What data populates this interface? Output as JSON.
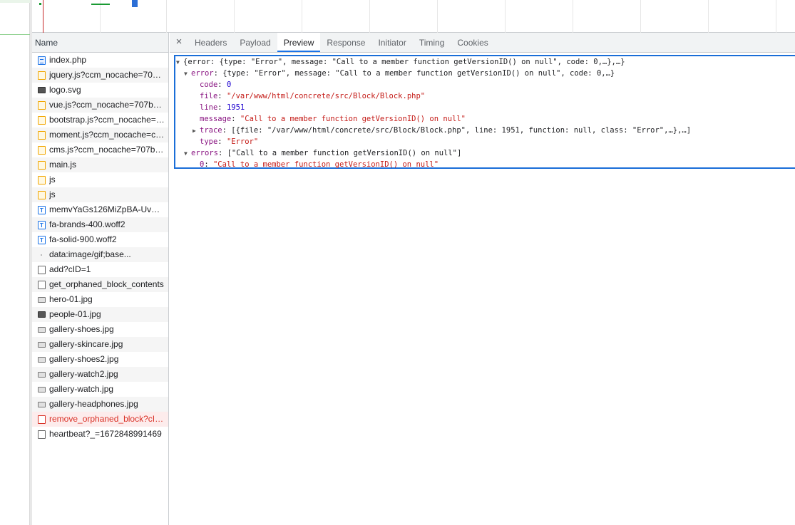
{
  "list": {
    "header": "Name",
    "rows": [
      {
        "name": "index.php",
        "icon": "document-icon",
        "alt": false
      },
      {
        "name": "jquery.js?ccm_nocache=707b...",
        "icon": "script-icon",
        "alt": true
      },
      {
        "name": "logo.svg",
        "icon": "image-icon",
        "alt": false
      },
      {
        "name": "vue.js?ccm_nocache=707b9b...",
        "icon": "script-icon",
        "alt": true
      },
      {
        "name": "bootstrap.js?ccm_nocache=9...",
        "icon": "script-icon",
        "alt": false
      },
      {
        "name": "moment.js?ccm_nocache=c3...",
        "icon": "script-icon",
        "alt": true
      },
      {
        "name": "cms.js?ccm_nocache=707b9...",
        "icon": "script-icon",
        "alt": false
      },
      {
        "name": "main.js",
        "icon": "script-icon",
        "alt": true
      },
      {
        "name": "js",
        "icon": "script-icon",
        "alt": false
      },
      {
        "name": "js",
        "icon": "script-icon",
        "alt": true
      },
      {
        "name": "memvYaGs126MiZpBA-UvW...",
        "icon": "font-icon",
        "alt": false
      },
      {
        "name": "fa-brands-400.woff2",
        "icon": "font-icon",
        "alt": true
      },
      {
        "name": "fa-solid-900.woff2",
        "icon": "font-icon",
        "alt": false
      },
      {
        "name": "data:image/gif;base...",
        "icon": "tiny-image-icon",
        "alt": true
      },
      {
        "name": "add?cID=1",
        "icon": "blank-document-icon",
        "alt": false
      },
      {
        "name": "get_orphaned_block_contents",
        "icon": "blank-document-icon",
        "alt": true
      },
      {
        "name": "hero-01.jpg",
        "icon": "image-icon",
        "alt": false
      },
      {
        "name": "people-01.jpg",
        "icon": "image-icon",
        "alt": true
      },
      {
        "name": "gallery-shoes.jpg",
        "icon": "image-icon",
        "alt": false
      },
      {
        "name": "gallery-skincare.jpg",
        "icon": "image-icon",
        "alt": true
      },
      {
        "name": "gallery-shoes2.jpg",
        "icon": "image-icon",
        "alt": false
      },
      {
        "name": "gallery-watch2.jpg",
        "icon": "image-icon",
        "alt": true
      },
      {
        "name": "gallery-watch.jpg",
        "icon": "image-icon",
        "alt": false
      },
      {
        "name": "gallery-headphones.jpg",
        "icon": "image-icon",
        "alt": true
      },
      {
        "name": "remove_orphaned_block?cID...",
        "icon": "error-document-icon",
        "alt": false,
        "error": true
      },
      {
        "name": "heartbeat?_=1672848991469",
        "icon": "blank-document-icon",
        "alt": false
      }
    ]
  },
  "tabs": {
    "close": "×",
    "items": [
      "Headers",
      "Payload",
      "Preview",
      "Response",
      "Initiator",
      "Timing",
      "Cookies"
    ],
    "active": "Preview"
  },
  "preview": {
    "line1": "{error: {type: \"Error\", message: \"Call to a member function getVersionID() on null\", code: 0,…},…}",
    "line2_key": "error",
    "line2_val": "{type: \"Error\", message: \"Call to a member function getVersionID() on null\", code: 0,…}",
    "code_key": "code",
    "code_val": "0",
    "file_key": "file",
    "file_val": "\"/var/www/html/concrete/src/Block/Block.php\"",
    "line_key": "line",
    "line_val": "1951",
    "message_key": "message",
    "message_val": "\"Call to a member function getVersionID() on null\"",
    "trace_key": "trace",
    "trace_val": "[{file: \"/var/www/html/concrete/src/Block/Block.php\", line: 1951, function: null, class: \"Error\",…},…]",
    "type_key": "type",
    "type_val": "\"Error\"",
    "errors_key": "errors",
    "errors_val": "[\"Call to a member function getVersionID() on null\"]",
    "errors0_key": "0",
    "errors0_val": "\"Call to a member function getVersionID() on null\""
  }
}
